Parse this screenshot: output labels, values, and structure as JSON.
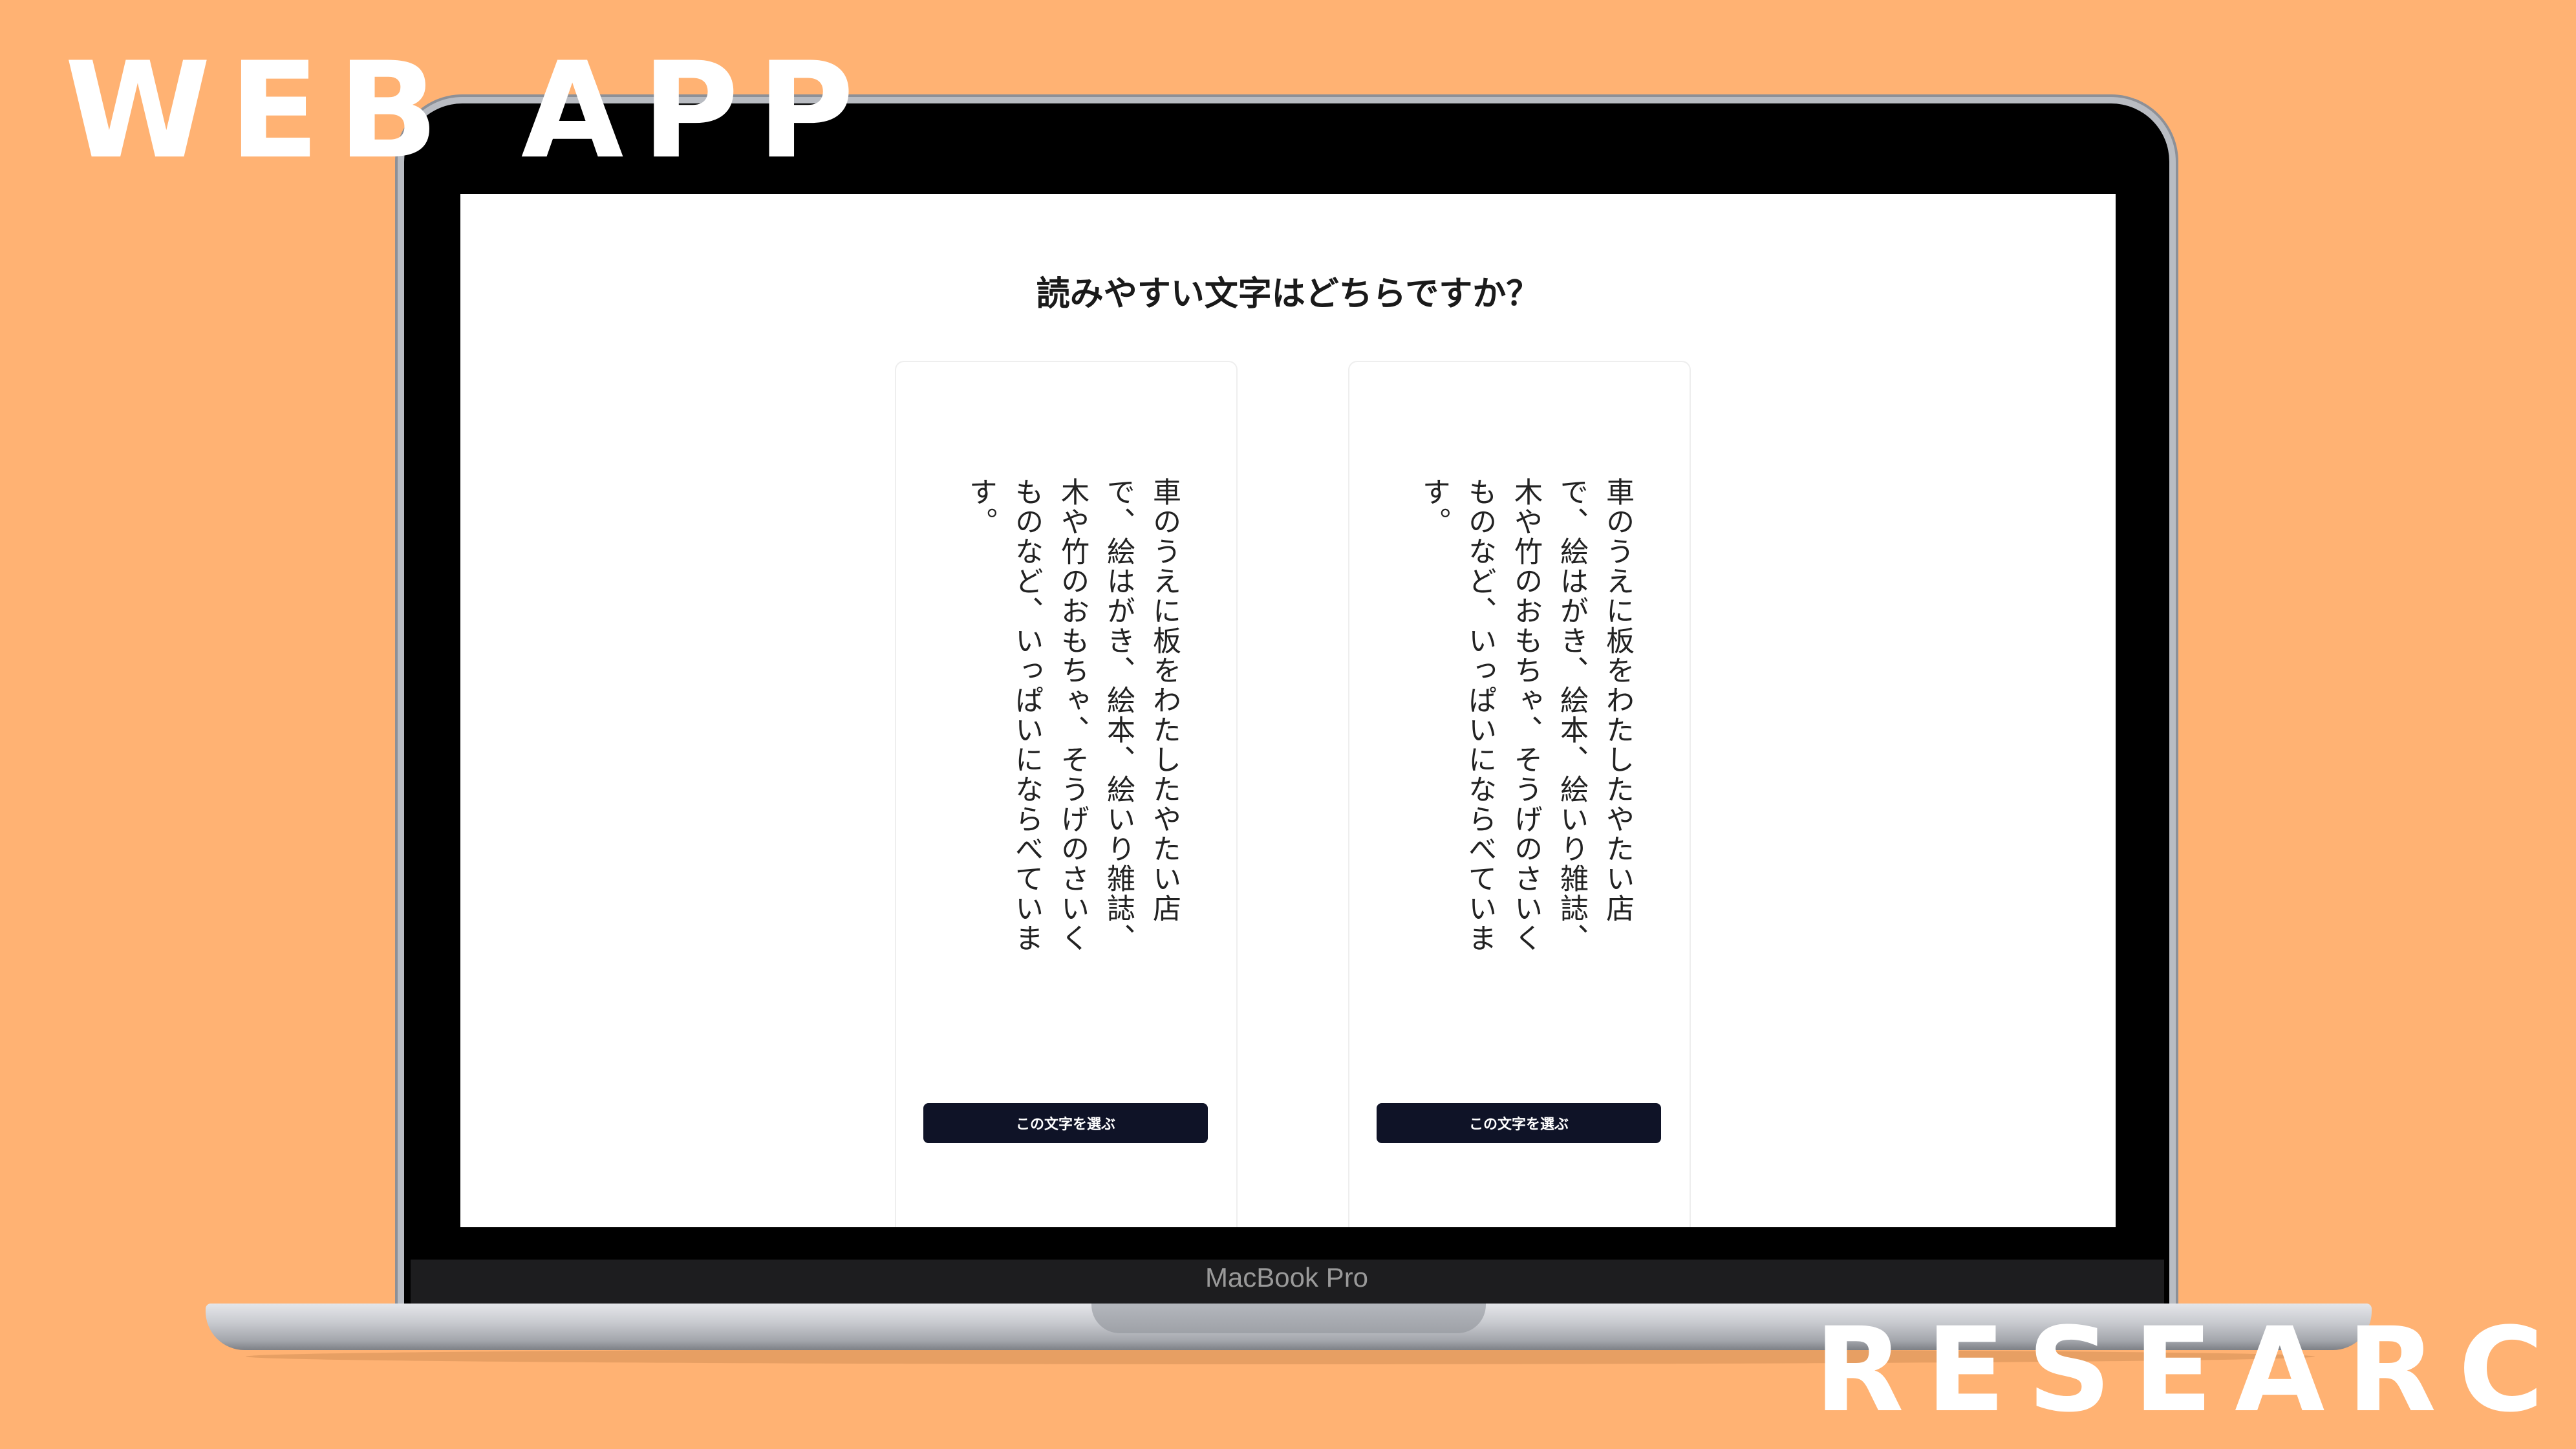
{
  "banner": {
    "top": "WEB APP",
    "bottom": "RESEARCH"
  },
  "device": {
    "model_label": "MacBook Pro"
  },
  "survey": {
    "question": "読みやすい文字はどちらですか？",
    "options": [
      {
        "sample_text": "車のうえに板をわたしたやたい店で、絵はがき、絵本、絵いり雑誌、木や竹のおもちゃ、そうげのさいくものなど、いっぱいにならべています。",
        "button_label": "この文字を選ぶ"
      },
      {
        "sample_text": "車のうえに板をわたしたやたい店で、絵はがき、絵本、絵いり雑誌、木や竹のおもちゃ、そうげのさいくものなど、いっぱいにならべています。",
        "button_label": "この文字を選ぶ"
      }
    ]
  },
  "colors": {
    "background": "#FFB273",
    "button": "#0f1327",
    "banner_text": "#ffffff"
  }
}
